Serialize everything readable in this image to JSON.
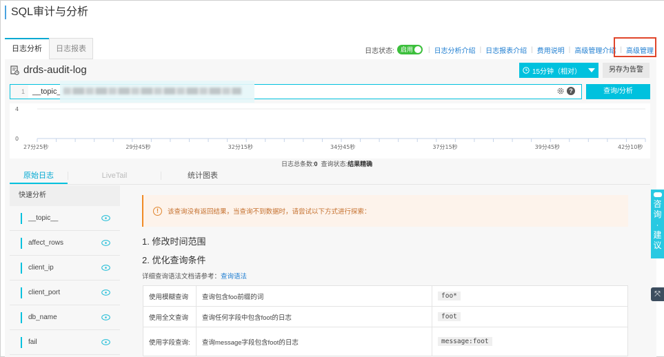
{
  "page": {
    "title": "SQL审计与分析"
  },
  "tabs": [
    {
      "label": "日志分析",
      "active": true
    },
    {
      "label": "日志报表",
      "active": false
    }
  ],
  "top_links": {
    "status_label": "日志状态:",
    "toggle_label": "启用",
    "toggle_on": true,
    "links": [
      "日志分析介绍",
      "日志报表介绍",
      "费用说明",
      "高级管理介绍",
      "高级管理"
    ]
  },
  "logstore": {
    "name": "drds-audit-log",
    "icon": "logstore-icon"
  },
  "toolbar": {
    "time_range": "15分钟（相对）",
    "save_alert": "另存为告警",
    "search_button": "查询/分析"
  },
  "query": {
    "line_number": "1",
    "text": "__topic_"
  },
  "chart_data": {
    "type": "bar",
    "title": "",
    "xlabel": "",
    "ylabel": "",
    "ylim": [
      0,
      4
    ],
    "y_ticks": [
      "0",
      "4"
    ],
    "x_tick_labels": [
      "27分25秒",
      "29分45秒",
      "32分15秒",
      "34分45秒",
      "37分15秒",
      "39分45秒",
      "42分10秒"
    ],
    "categories": [],
    "values": [],
    "grid": true
  },
  "summary": {
    "count_label": "日志总条数:",
    "count_value": "0",
    "status_label": "查询状态:",
    "status_value": "结果精确"
  },
  "result_tabs": [
    {
      "label": "原始日志",
      "active": true
    },
    {
      "label": "LiveTail",
      "disabled": true
    },
    {
      "label": "统计图表",
      "active": false
    }
  ],
  "sidebar": {
    "title": "快速分析",
    "fields": [
      "__topic__",
      "affect_rows",
      "client_ip",
      "client_port",
      "db_name",
      "fail"
    ]
  },
  "content": {
    "warning": "该查询没有返回结果，当查询不到数据时，请尝试以下方式进行探索：",
    "step1": "1. 修改时间范围",
    "step2": "2. 优化查询条件",
    "ref_label": "详细查询语法文档请参考：",
    "ref_link": "查询语法",
    "tips": [
      {
        "type": "使用模糊查询",
        "desc": "查询包含foo前缀的词",
        "example": "foo*"
      },
      {
        "type": "使用全文查询",
        "desc": "查询任何字段中包含foot的日志",
        "example": "foot"
      },
      {
        "type": "使用字段查询:",
        "desc": "查询message字段包含foot的日志",
        "example": "message:foot"
      }
    ]
  },
  "feedback": {
    "label": "咨询·建议"
  }
}
